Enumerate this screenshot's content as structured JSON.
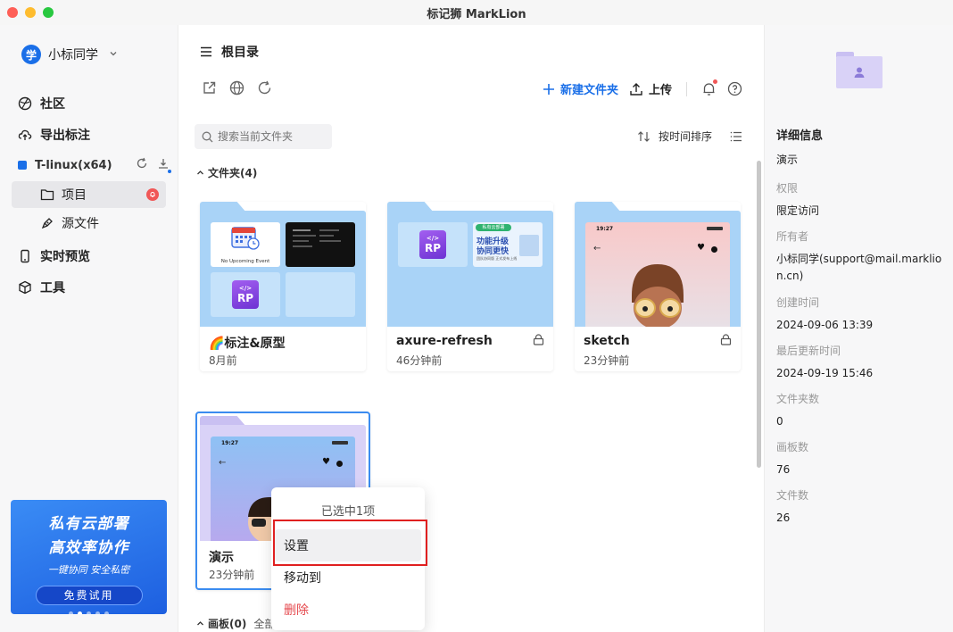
{
  "window": {
    "title": "标记狮 MarkLion"
  },
  "sidebar": {
    "user": {
      "avatar": "学",
      "name": "小标同学"
    },
    "items": [
      {
        "label": "社区",
        "icon": "community-icon"
      },
      {
        "label": "导出标注",
        "icon": "export-icon"
      }
    ],
    "team": {
      "name": "T-linux(x64)"
    },
    "sub_items": [
      {
        "label": "项目",
        "icon": "folder-icon"
      },
      {
        "label": "源文件",
        "icon": "pen-icon"
      }
    ],
    "bottom_items": [
      {
        "label": "实时预览",
        "icon": "phone-icon"
      },
      {
        "label": "工具",
        "icon": "cube-icon"
      }
    ],
    "promo": {
      "line1": "私有云部署",
      "line2": "高效率协作",
      "line3": "一键协同   安全私密",
      "button": "免费试用"
    }
  },
  "main": {
    "breadcrumb": "根目录",
    "toolbar": {
      "new_folder": "新建文件夹",
      "upload": "上传"
    },
    "search": {
      "placeholder": "搜索当前文件夹"
    },
    "sort_label": "按时间排序",
    "folders_section": "文件夹(4)",
    "boards_section": "画板(0)",
    "boards_filter": "全部",
    "folders": [
      {
        "name": "🌈标注&原型",
        "time": "8月前",
        "locked": false,
        "thumb_text": "No Upcoming Event"
      },
      {
        "name": "axure-refresh",
        "time": "46分钟前",
        "locked": true,
        "thumb_tag": "私有云部署",
        "thumb_line1": "功能升级",
        "thumb_line2": "协同更快",
        "thumb_line3": "团队协同版  正式发布上线"
      },
      {
        "name": "sketch",
        "time": "23分钟前",
        "locked": true,
        "thumb_clock": "19:27"
      },
      {
        "name": "演示",
        "time": "23分钟前",
        "locked": false,
        "thumb_clock": "19:27"
      }
    ],
    "rp_label": "RP",
    "context_menu": {
      "header": "已选中1项",
      "items": [
        {
          "label": "设置"
        },
        {
          "label": "移动到"
        },
        {
          "label": "删除"
        }
      ]
    }
  },
  "details": {
    "title": "详细信息",
    "name": "演示",
    "rows": [
      {
        "label": "权限",
        "value": "限定访问"
      },
      {
        "label": "所有者",
        "value": "小标同学(support@mail.marklion.cn)"
      },
      {
        "label": "创建时间",
        "value": "2024-09-06 13:39"
      },
      {
        "label": "最后更新时间",
        "value": "2024-09-19 15:46"
      },
      {
        "label": "文件夹数",
        "value": "0"
      },
      {
        "label": "画板数",
        "value": "76"
      },
      {
        "label": "文件数",
        "value": "26"
      }
    ]
  },
  "colors": {
    "accent": "#1a6fe8",
    "folder": "#a9d3f7",
    "danger": "#e5484d",
    "highlight": "#e02020"
  }
}
